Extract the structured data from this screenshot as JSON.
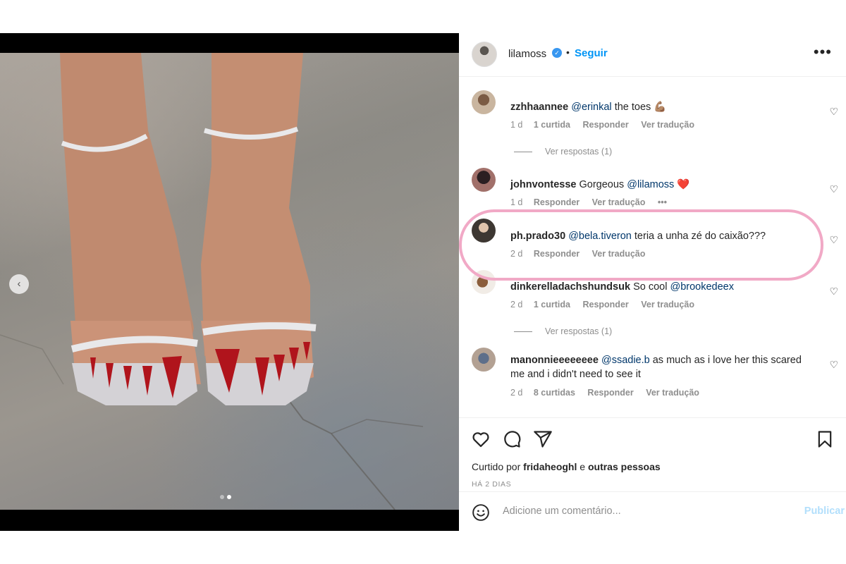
{
  "post": {
    "username": "lilamoss",
    "verified_icon": "verified-badge-icon",
    "separator": "•",
    "follow_label": "Seguir",
    "more_icon": "more-options-icon",
    "more_glyph": "•••"
  },
  "media": {
    "carousel_prev_glyph": "‹",
    "dots_total": 2,
    "dots_active": 2
  },
  "comments": [
    {
      "username": "zzhhaannee",
      "mention": "@erinkal",
      "text": "the toes 💪🏽",
      "time": "1 d",
      "likes": "1 curtida",
      "reply": "Responder",
      "translate": "Ver tradução",
      "view_replies": "Ver respostas (1)"
    },
    {
      "username": "johnvontesse",
      "text_before": "Gorgeous",
      "mention": "@lilamoss",
      "text": "❤️",
      "time": "1 d",
      "reply": "Responder",
      "translate": "Ver tradução",
      "options": "•••"
    },
    {
      "username": "ph.prado30",
      "mention": "@bela.tiveron",
      "text": "teria a unha zé do caixão???",
      "time": "2 d",
      "reply": "Responder",
      "translate": "Ver tradução"
    },
    {
      "username": "dinkerelladachshundsuk",
      "text_before": "So cool",
      "mention": "@brookedeex",
      "time": "2 d",
      "likes": "1 curtida",
      "reply": "Responder",
      "translate": "Ver tradução",
      "view_replies": "Ver respostas (1)"
    },
    {
      "username": "manonnieeeeeeee",
      "mention": "@ssadie.b",
      "text": "as much as i love her this scared me and i didn't need to see it",
      "time": "2 d",
      "likes": "8 curtidas",
      "reply": "Responder",
      "translate": "Ver tradução"
    }
  ],
  "heart_glyph": "♡",
  "actions": {
    "like_icon": "heart-icon",
    "comment_icon": "comment-icon",
    "share_icon": "share-icon",
    "save_icon": "bookmark-icon"
  },
  "likes_summary": {
    "prefix": "Curtido por",
    "user": "fridaheoghl",
    "connector": "e",
    "others": "outras pessoas"
  },
  "date": "HÁ 2 DIAS",
  "add_comment": {
    "placeholder": "Adicione um comentário...",
    "publish_label": "Publicar"
  },
  "colors": {
    "accent": "#0095f6",
    "mention": "#00376b",
    "muted": "#8e8e8e",
    "publish_disabled": "#b2dffc",
    "highlight_ring": "#f1a9c6"
  }
}
